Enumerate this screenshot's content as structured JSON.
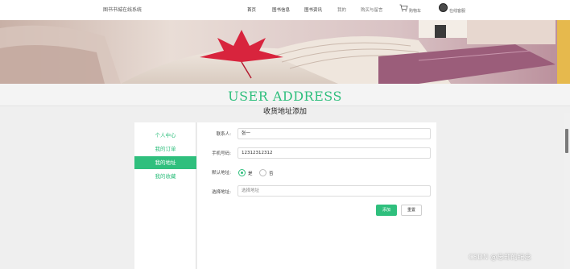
{
  "header": {
    "site_name": "图书书城在线系统",
    "nav": [
      "首页",
      "图书信息",
      "图书资讯",
      "我的",
      "购买与留言"
    ],
    "cart_label": "购物车",
    "user_label": "在线客服"
  },
  "page": {
    "title": "USER ADDRESS",
    "subtitle": "收货地址添加"
  },
  "sidebar": {
    "items": [
      {
        "label": "个人中心",
        "active": false
      },
      {
        "label": "我的订单",
        "active": false
      },
      {
        "label": "我的地址",
        "active": true
      },
      {
        "label": "我的收藏",
        "active": false
      }
    ]
  },
  "form": {
    "contact_label": "联系人:",
    "contact_value": "张一",
    "phone_label": "手机号码:",
    "phone_value": "12312312312",
    "default_label": "默认地址:",
    "radio_yes": "是",
    "radio_no": "否",
    "default_selected": "是",
    "address_label": "选择地址:",
    "address_placeholder": "选择地址",
    "add_button": "添加",
    "reset_button": "重置"
  },
  "watermark": "CSDN @忘却的纪念",
  "colors": {
    "accent": "#2fbf7d",
    "banner_leaf": "#d8243d"
  }
}
